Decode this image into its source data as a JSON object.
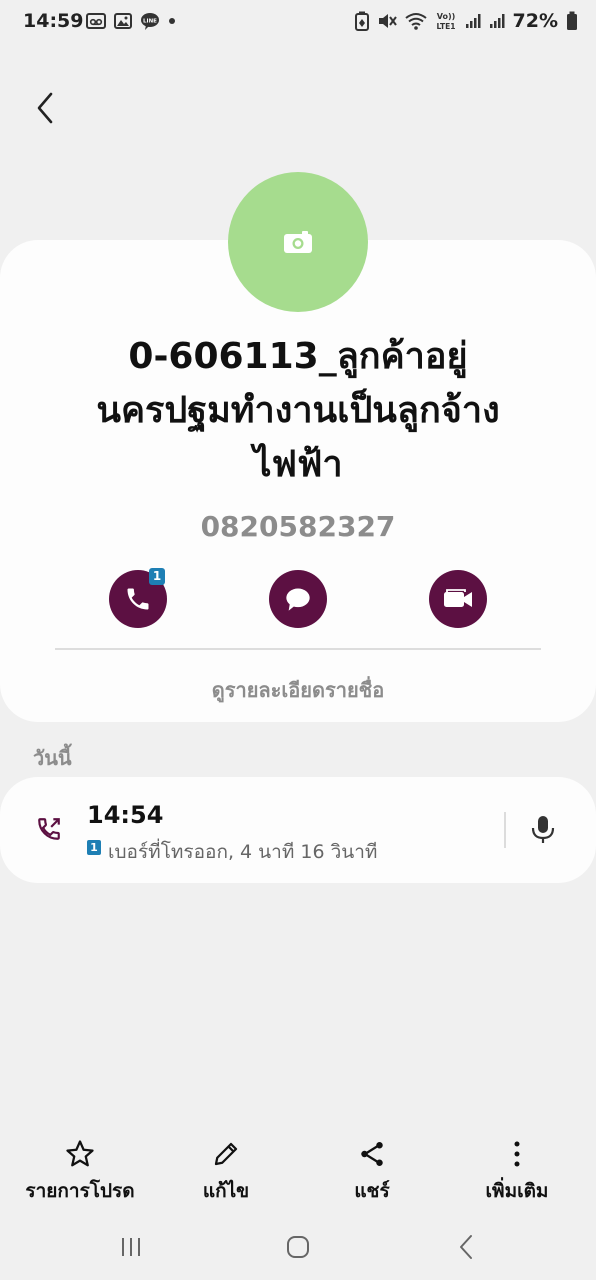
{
  "status_bar": {
    "time": "14:59",
    "battery": "72%",
    "network": "VoLTE1"
  },
  "contact": {
    "name": "0-606113_ลูกค้าอยู่นครปฐมทำงานเป็นลูกจ้างไฟฟ้า",
    "name_lines": [
      "0-606113_ลูกค้าอยู่",
      "นครปฐมทำงานเป็นลูกจ้าง",
      "ไฟฟ้า"
    ],
    "phone": "0820582327",
    "sim_badge": "1",
    "avatar_color": "#a6dc8e",
    "view_details": "ดูรายละเอียดรายชื่อ"
  },
  "actions": {
    "call_icon": "phone-icon",
    "message_icon": "message-icon",
    "video_icon": "video-call-icon",
    "color": "#5c1042"
  },
  "history": {
    "section_label": "วันนี้",
    "entries": [
      {
        "time": "14:54",
        "sim": "1",
        "detail": "เบอร์ที่โทรออก, 4 นาที 16 วินาที",
        "type_icon": "outgoing-call-icon",
        "action_icon": "microphone-icon"
      }
    ]
  },
  "bottom_bar": {
    "favorites": "รายการโปรด",
    "edit": "แก้ไข",
    "share": "แชร์",
    "more": "เพิ่มเติม"
  }
}
